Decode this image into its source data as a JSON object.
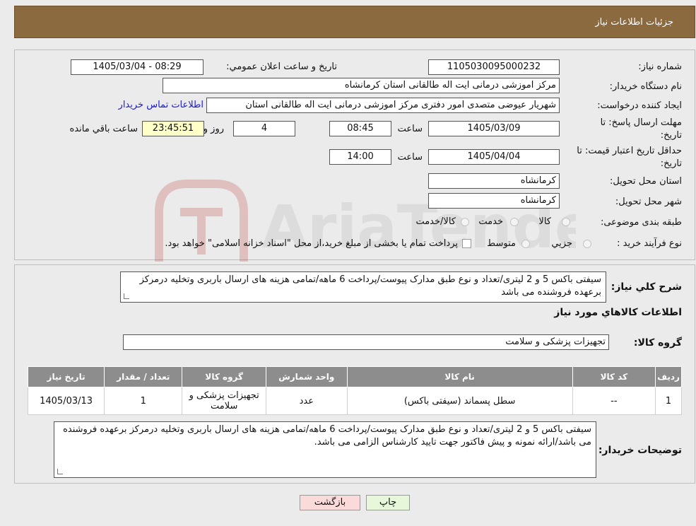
{
  "header": {
    "title": "جزئیات اطلاعات نیاز"
  },
  "form": {
    "need_number_label": "شماره نیاز:",
    "need_number": "1105030095000232",
    "announce_label": "تاریخ و ساعت اعلان عمومي:",
    "announce_value": "1405/03/04 - 08:29",
    "buyer_org_label": "نام دستگاه خريدار:",
    "buyer_org": "مرکز اموزشی درمانی ایت اله طالقانی استان کرمانشاه",
    "requester_label": "ايجاد کننده درخواست:",
    "requester": "شهریار عیوضی متصدی امور دفتری مرکز اموزشی درمانی ایت اله طالقانی استان",
    "contact_link": "اطلاعات تماس خريدار",
    "reply_deadline_label_1": "مهلت ارسال پاسخ: تا",
    "reply_deadline_label_2": "تاريخ:",
    "reply_date": "1405/03/09",
    "time_label": "ساعت",
    "reply_time": "08:45",
    "days_value": "4",
    "days_label": "روز و",
    "remaining_value": "23:45:51",
    "remaining_label": "ساعت باقي مانده",
    "price_validity_label_1": "حداقل تاريخ اعتبار قيمت: تا",
    "price_validity_label_2": "تاريخ:",
    "price_date": "1405/04/04",
    "price_time_label": "ساعت",
    "price_time": "14:00",
    "province_label": "استان محل تحويل:",
    "province": "کرمانشاه",
    "city_label": "شهر محل تحويل:",
    "city": "کرمانشاه",
    "category_label": "طبقه بندی موضوعی:",
    "category_options": [
      "کالا",
      "خدمت",
      "کالا/خدمت"
    ],
    "purchase_type_label": "نوع فرآيند خريد :",
    "purchase_options": [
      "جزيي",
      "متوسط"
    ],
    "purchase_note": "پرداخت تمام يا بخشی از مبلغ خريد،از محل \"اسناد خزانه اسلامی\" خواهد بود."
  },
  "details": {
    "summary_label": "شرح کلي نياز:",
    "summary": "سیفتی باکس 5 و 2 لیتری/تعداد و نوع طبق مدارک پیوست/پرداخت 6 ماهه/تمامی هزینه های ارسال باربری وتخلیه درمرکز برعهده فروشنده می باشد",
    "goods_info_title": "اطلاعات کالاهاي مورد نياز",
    "goods_group_label": "گروه کالا:",
    "goods_group": "تجهیزات پزشکی و سلامت"
  },
  "table": {
    "headers": [
      "رديف",
      "کد کالا",
      "نام کالا",
      "واحد شمارش",
      "گروه کالا",
      "تعداد / مقدار",
      "تاريخ نياز"
    ],
    "rows": [
      {
        "row": "1",
        "code": "--",
        "name": "سطل پسماند (سیفتی باکس)",
        "unit": "عدد",
        "group": "تجهیزات پزشکی و سلامت",
        "qty": "1",
        "date": "1405/03/13"
      }
    ]
  },
  "buyer_notes": {
    "label": "توضيحات خريدار:",
    "text": "سیفتی باکس 5 و 2 لیتری/تعداد و نوع طبق مدارک پیوست/پرداخت 6 ماهه/تمامی هزینه های ارسال باربری وتخلیه درمرکز برعهده فروشنده می باشد/ارائه نمونه و پیش فاکتور جهت تایید کارشناس الزامی می باشد."
  },
  "buttons": {
    "print": "چاپ",
    "back": "بازگشت"
  },
  "watermark": {
    "text": "AriaTender.neT"
  },
  "colors": {
    "header": "#8b6a3f",
    "print_button": "#e6f7da",
    "back_button": "#fbdada",
    "table_header": "#8d8d8d"
  }
}
